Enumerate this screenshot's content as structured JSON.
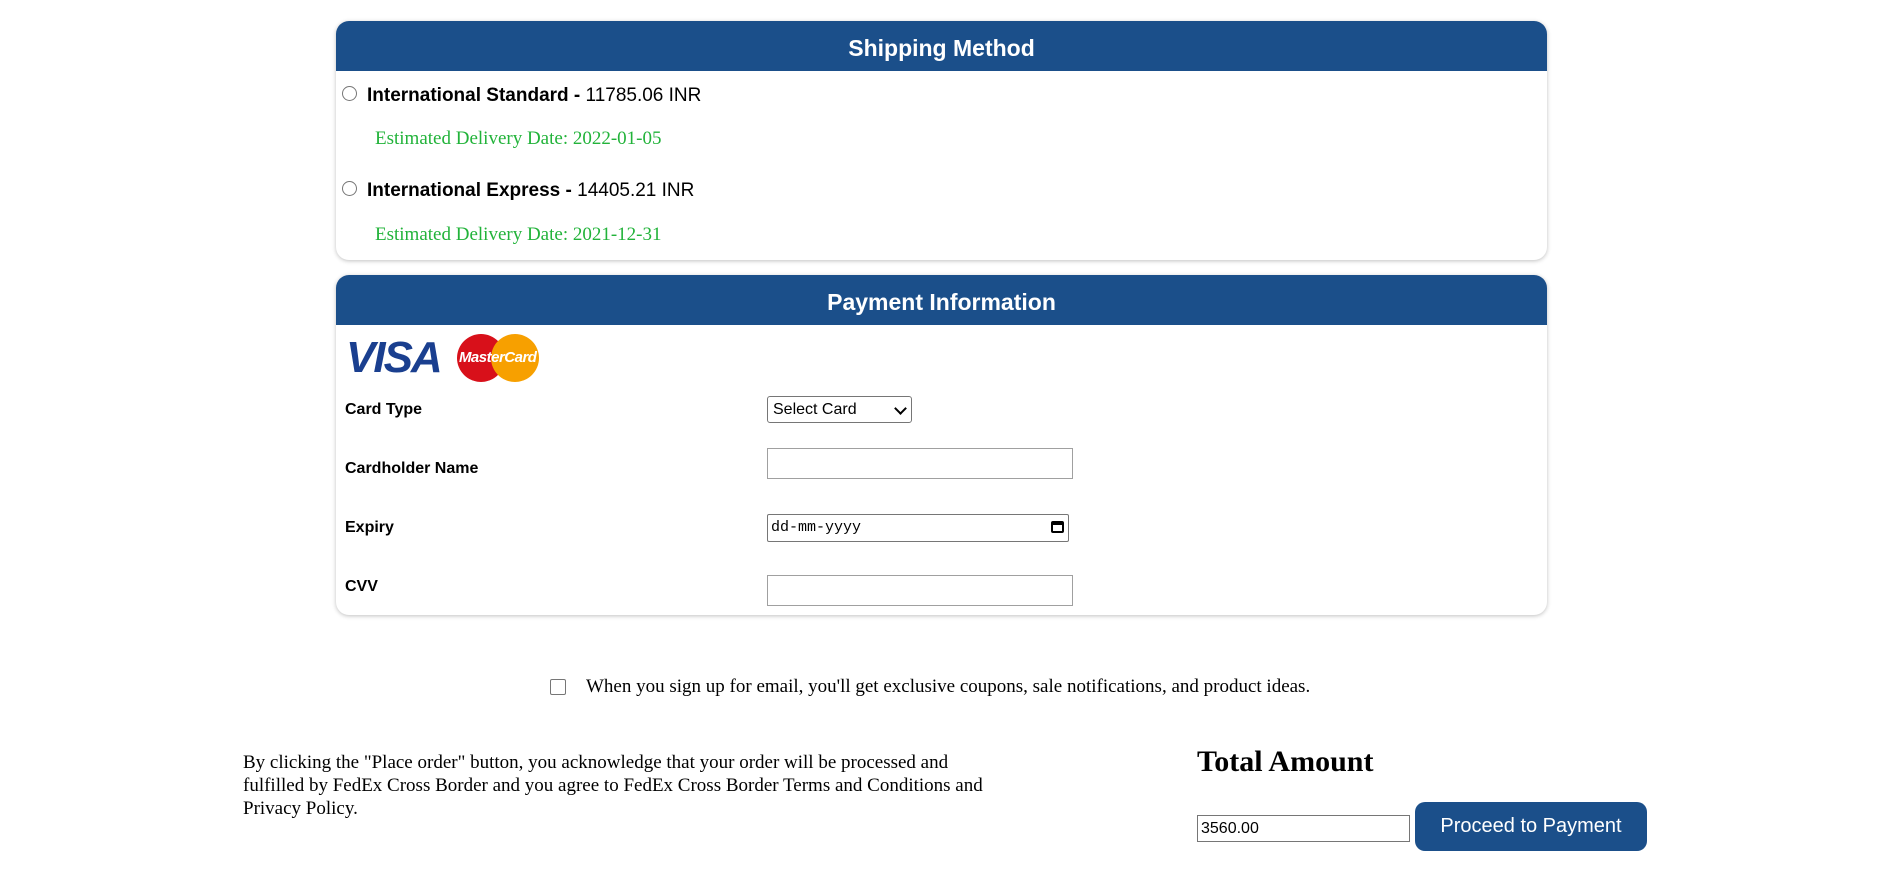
{
  "shipping": {
    "header": "Shipping Method",
    "options": [
      {
        "name": "International Standard",
        "separator": " - ",
        "price": "11785.06 INR",
        "eta": "Estimated Delivery Date: 2022-01-05"
      },
      {
        "name": "International Express",
        "separator": " - ",
        "price": "14405.21 INR",
        "eta": "Estimated Delivery Date: 2021-12-31"
      }
    ]
  },
  "payment": {
    "header": "Payment Information",
    "logos": {
      "visa": "VISA",
      "mastercard": "MasterCard"
    },
    "fields": {
      "card_type_label": "Card Type",
      "card_type_value": "Select Card",
      "cardholder_label": "Cardholder Name",
      "cardholder_value": "",
      "expiry_label": "Expiry",
      "expiry_placeholder": "dd-mm-yyyy",
      "cvv_label": "CVV",
      "cvv_value": ""
    }
  },
  "signup": {
    "text": "When you sign up for email, you'll get exclusive coupons, sale notifications, and product ideas."
  },
  "terms": {
    "text": "By clicking the \"Place order\" button, you acknowledge that your order will be processed and fulfilled by FedEx Cross Border and you agree to FedEx Cross Border Terms and Conditions and Privacy Policy."
  },
  "total": {
    "title": "Total Amount",
    "amount": "3560.00",
    "button": "Proceed to Payment"
  },
  "colors": {
    "header_bg": "#1b4f8a",
    "eta_green": "#22b33a"
  }
}
